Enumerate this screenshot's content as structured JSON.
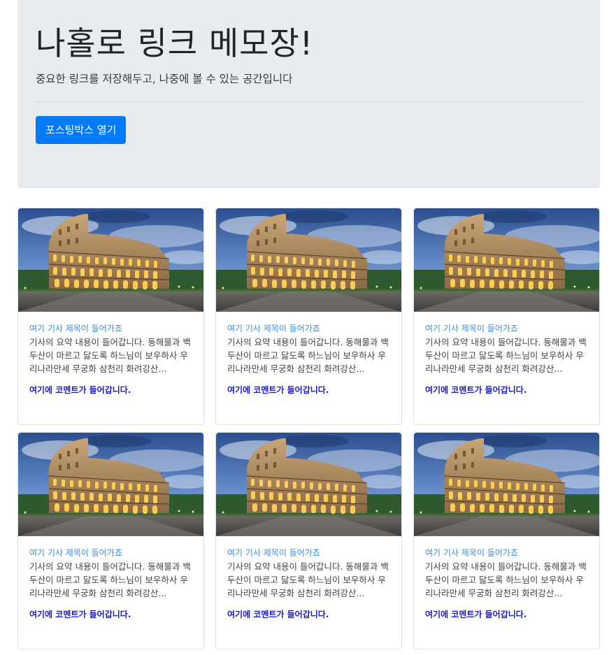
{
  "jumbotron": {
    "title": "나홀로 링크 메모장!",
    "subtitle": "중요한 링크를 저장해두고, 나중에 볼 수 있는 공간입니다",
    "open_button_label": "포스팅박스 열기"
  },
  "cards": [
    {
      "title": "여기 기사 제목이 들어가죠",
      "text": "기사의 요약 내용이 들어갑니다. 동해물과 백두산이 마르고 닳도록 하느님이 보우하사 우리나라만세 무궁화 삼천리 화려강산...",
      "comment": "여기에 코멘트가 들어갑니다."
    },
    {
      "title": "여기 기사 제목이 들어가죠",
      "text": "기사의 요약 내용이 들어갑니다. 동해물과 백두산이 마르고 닳도록 하느님이 보우하사 우리나라만세 무궁화 삼천리 화려강산...",
      "comment": "여기에 코멘트가 들어갑니다."
    },
    {
      "title": "여기 기사 제목이 들어가죠",
      "text": "기사의 요약 내용이 들어갑니다. 동해물과 백두산이 마르고 닳도록 하느님이 보우하사 우리나라만세 무궁화 삼천리 화려강산...",
      "comment": "여기에 코멘트가 들어갑니다."
    },
    {
      "title": "여기 기사 제목이 들어가죠",
      "text": "기사의 요약 내용이 들어갑니다. 동해물과 백두산이 마르고 닳도록 하느님이 보우하사 우리나라만세 무궁화 삼천리 화려강산...",
      "comment": "여기에 코멘트가 들어갑니다."
    },
    {
      "title": "여기 기사 제목이 들어가죠",
      "text": "기사의 요약 내용이 들어갑니다. 동해물과 백두산이 마르고 닳도록 하느님이 보우하사 우리나라만세 무궁화 삼천리 화려강산...",
      "comment": "여기에 코멘트가 들어갑니다."
    },
    {
      "title": "여기 기사 제목이 들어가죠",
      "text": "기사의 요약 내용이 들어갑니다. 동해물과 백두산이 마르고 닳도록 하느님이 보우하사 우리나라만세 무궁화 삼천리 화려강산...",
      "comment": "여기에 코멘트가 들어갑니다."
    }
  ],
  "colors": {
    "jumbotron_bg": "#e9ecef",
    "primary": "#007bff",
    "card_title": "#3b8de0",
    "comment": "#1c1ccc"
  },
  "icons": {
    "card_image": "colosseum-photo"
  }
}
